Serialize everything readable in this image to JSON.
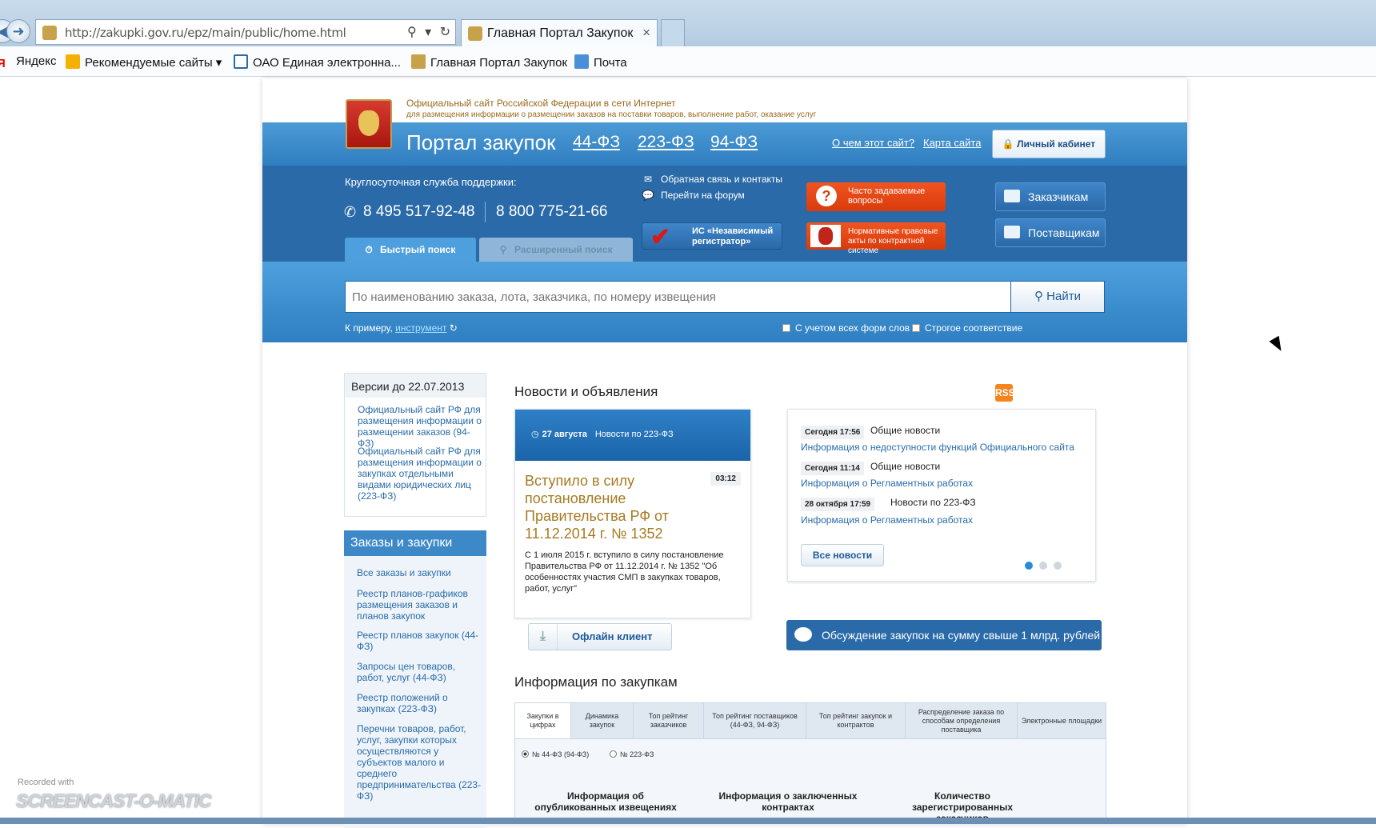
{
  "browser": {
    "url": "http://zakupki.gov.ru/epz/main/public/home.html",
    "tab_title": "Главная Портал Закупок",
    "tab_close": "×",
    "favorites": [
      "Яндекс",
      "Рекомендуемые сайты",
      "ОАО Единая электронна...",
      "Главная Портал Закупок",
      "Почта"
    ]
  },
  "header": {
    "official_line1": "Официальный сайт Российской Федерации в сети Интернет",
    "official_line2": "для размещения информации о размещении заказов на поставки товаров, выполнение работ, оказание услуг",
    "portal_title": "Портал закупок",
    "laws": [
      "44-ФЗ",
      "223-ФЗ",
      "94-ФЗ"
    ],
    "about_link": "О чем этот сайт?",
    "sitemap_link": "Карта сайта",
    "cabinet_button": "Личный кабинет"
  },
  "support": {
    "label": "Круглосуточная служба поддержки:",
    "phone1": "8 495 517-92-48",
    "phone2": "8 800 775-21-66"
  },
  "mid_links": {
    "feedback": "Обратная связь и контакты",
    "forum": "Перейти на форум",
    "registrar": "ИС «Независимый регистратор»"
  },
  "buttons": {
    "faq": "Часто задаваемые вопросы",
    "normative": "Нормативные правовые акты по контрактной системе",
    "customers": "Заказчикам",
    "suppliers": "Поставщикам"
  },
  "search": {
    "tab_quick": "Быстрый поиск",
    "tab_advanced": "Расширенный поиск",
    "placeholder": "По наименованию заказа, лота, заказчика, по номеру извещения",
    "button": "Найти",
    "example_prefix": "К примеру,",
    "example_link": "инструмент",
    "opt_all_forms": "С учетом всех форм слов",
    "opt_strict": "Строгое соответствие"
  },
  "sidebar": {
    "versions_title": "Версии до 22.07.2013",
    "versions": [
      "Официальный сайт РФ для размещения информации о размещении заказов (94-ФЗ)",
      "Официальный сайт РФ для размещения информации о закупках отдельными видами юридических лиц (223-ФЗ)"
    ],
    "orders_title": "Заказы и закупки",
    "orders": [
      "Все заказы и закупки",
      "Реестр планов-графиков размещения заказов и планов закупок",
      "Реестр планов закупок (44-ФЗ)",
      "Запросы цен товаров, работ, услуг (44-ФЗ)",
      "Реестр положений о закупках (223-ФЗ)",
      "Перечни товаров, работ, услуг, закупки которых осуществляются у субъектов малого и среднего предпринимательства (223-ФЗ)"
    ]
  },
  "news": {
    "title": "Новости и объявления",
    "rss": "RSS",
    "featured": {
      "date": "27 августа",
      "category": "Новости по 223-ФЗ",
      "time": "03:12",
      "headline": "Вступило в силу постановление Правительства РФ от 11.12.2014 г. № 1352",
      "body": "С 1 июля 2015 г. вступило в силу постановление Правительства РФ от 11.12.2014 г. № 1352 \"Об особенностях участия СМП в закупках товаров, работ, услуг\""
    },
    "feed": [
      {
        "date": "Сегодня 17:56",
        "category": "Общие новости",
        "link": "Информация о недоступности функций Официального сайта"
      },
      {
        "date": "Сегодня 11:14",
        "category": "Общие новости",
        "link": "Информация о Регламентных работах"
      },
      {
        "date": "28 октября 17:59",
        "category": "Новости по 223-ФЗ",
        "link": "Информация о Регламентных работах"
      }
    ],
    "all_news": "Все новости",
    "offline_client": "Офлайн клиент",
    "discuss": "Обсуждение закупок на сумму свыше 1 млрд. рублей"
  },
  "info": {
    "title": "Информация по закупкам",
    "tabs": [
      "Закупки в цифрах",
      "Динамика закупок",
      "Топ рейтинг заказчиков",
      "Топ рейтинг поставщиков (44-ФЗ, 94-ФЗ)",
      "Топ рейтинг закупок и контрактов",
      "Распределение заказа по способам определения поставщика",
      "Электронные площадки"
    ],
    "radio_44": "№ 44-ФЗ (94-ФЗ)",
    "radio_223": "№ 223-ФЗ",
    "col1": "Информация об опубликованных извещениях",
    "col2": "Информация о заключенных контрактах",
    "col3": "Количество зарегистрированных заказчиков"
  },
  "watermark": {
    "small": "Recorded with",
    "big": "SCREENCAST-O-MATIC"
  }
}
